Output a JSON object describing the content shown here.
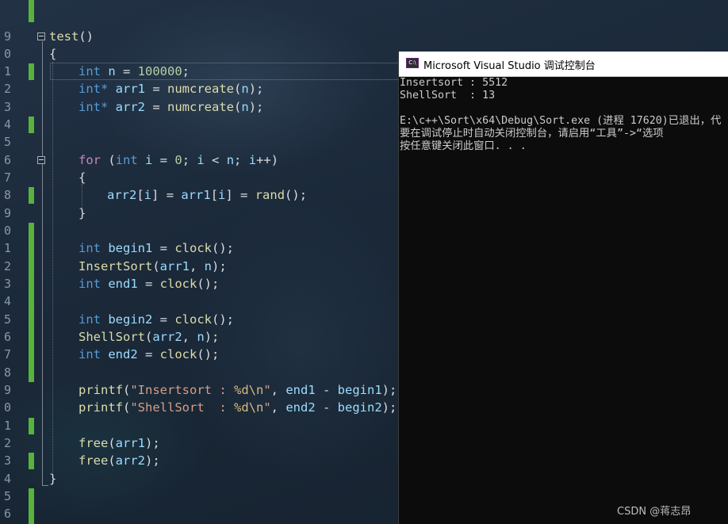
{
  "editor": {
    "line_numbers": [
      "",
      "9",
      "0",
      "1",
      "2",
      "3",
      "4",
      "5",
      "6",
      "7",
      "8",
      "9",
      "0",
      "1",
      "2",
      "3",
      "4",
      "5",
      "6",
      "7",
      "8",
      "9",
      "0",
      "1",
      "2",
      "3",
      "4",
      "5",
      "6"
    ],
    "code": {
      "func": "test",
      "func_parens": "()",
      "open_brace": "{",
      "l1_kw": "int",
      "l1_var": " n",
      "l1_eq": " = ",
      "l1_num": "100000",
      "l1_end": ";",
      "l2_kw": "int*",
      "l2_var": " arr1",
      "l2_eq": " = ",
      "l2_fn": "numcreate",
      "l2_open": "(",
      "l2_arg": "n",
      "l2_end": ");",
      "l3_kw": "int*",
      "l3_var": " arr2",
      "l3_eq": " = ",
      "l3_fn": "numcreate",
      "l3_open": "(",
      "l3_arg": "n",
      "l3_end": ");",
      "for_kw": "for",
      "for_open": " (",
      "for_int": "int",
      "for_i": " i",
      "for_eq": " = ",
      "for_zero": "0",
      "for_semi1": "; ",
      "for_i2": "i",
      "for_lt": " < ",
      "for_n": "n",
      "for_semi2": "; ",
      "for_i3": "i",
      "for_inc": "++)",
      "for_brace_open": "{",
      "body_arr2": "arr2",
      "body_b1": "[",
      "body_i1": "i",
      "body_b2": "]",
      "body_eq": " = ",
      "body_arr1": "arr1",
      "body_b3": "[",
      "body_i2": "i",
      "body_b4": "]",
      "body_eq2": " = ",
      "body_rand": "rand",
      "body_end": "();",
      "for_brace_close": "}",
      "b1_kw": "int",
      "b1_var": " begin1",
      "b1_eq": " = ",
      "b1_fn": "clock",
      "b1_end": "();",
      "is_fn": "InsertSort",
      "is_open": "(",
      "is_a1": "arr1",
      "is_comma": ", ",
      "is_n": "n",
      "is_end": ");",
      "e1_kw": "int",
      "e1_var": " end1",
      "e1_eq": " = ",
      "e1_fn": "clock",
      "e1_end": "();",
      "b2_kw": "int",
      "b2_var": " begin2",
      "b2_eq": " = ",
      "b2_fn": "clock",
      "b2_end": "();",
      "ss_fn": "ShellSort",
      "ss_open": "(",
      "ss_a2": "arr2",
      "ss_comma": ", ",
      "ss_n": "n",
      "ss_end": ");",
      "e2_kw": "int",
      "e2_var": " end2",
      "e2_eq": " = ",
      "e2_fn": "clock",
      "e2_end": "();",
      "p1_fn": "printf",
      "p1_open": "(",
      "p1_str1": "\"Insertsort : ",
      "p1_fmt": "%d\\n",
      "p1_str2": "\"",
      "p1_comma": ", ",
      "p1_e": "end1",
      "p1_minus": " - ",
      "p1_b": "begin1",
      "p1_end": ");",
      "p2_fn": "printf",
      "p2_open": "(",
      "p2_str1": "\"ShellSort  : ",
      "p2_fmt": "%d\\n",
      "p2_str2": "\"",
      "p2_comma": ", ",
      "p2_e": "end2",
      "p2_minus": " - ",
      "p2_b": "begin2",
      "p2_end": ");",
      "f1_fn": "free",
      "f1_open": "(",
      "f1_arg": "arr1",
      "f1_end": ");",
      "f2_fn": "free",
      "f2_open": "(",
      "f2_arg": "arr2",
      "f2_end": ");",
      "close_brace": "}"
    }
  },
  "console": {
    "icon_label": "C:\\",
    "title": "Microsoft Visual Studio 调试控制台",
    "lines": [
      "Insertsort : 5512",
      "ShellSort  : 13",
      "",
      "E:\\c++\\Sort\\x64\\Debug\\Sort.exe (进程 17620)已退出，代",
      "要在调试停止时自动关闭控制台，请启用“工具”->“选项",
      "按任意键关闭此窗口. . ."
    ]
  },
  "watermark": "CSDN @蒋志昂",
  "colors": {
    "keyword": "#569cd6",
    "control_keyword": "#c586c0",
    "function": "#dcdcaa",
    "variable": "#9cdcfe",
    "number": "#b5cea8",
    "string": "#d69d85",
    "change_bar": "#57b33c",
    "console_bg": "#0c0c0c"
  }
}
